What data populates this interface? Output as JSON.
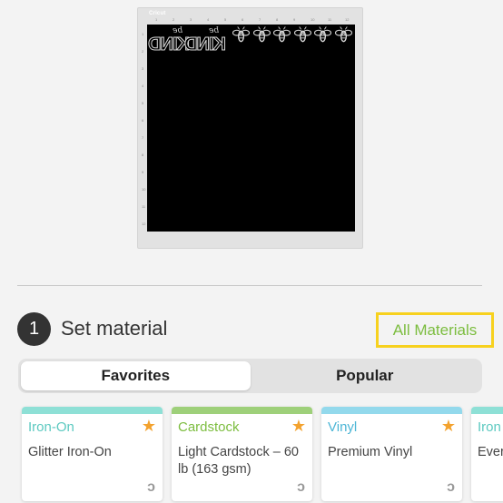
{
  "mat": {
    "brand": "Cricut",
    "ruler_top": [
      "1",
      "2",
      "3",
      "4",
      "5",
      "6",
      "7",
      "8",
      "9",
      "10",
      "11",
      "12"
    ],
    "ruler_left": [
      "1",
      "2",
      "3",
      "4",
      "5",
      "6",
      "7",
      "8",
      "9",
      "10",
      "11",
      "12"
    ],
    "design_text": "KIND",
    "design_script": "be"
  },
  "step": {
    "number": "1",
    "title": "Set material"
  },
  "all_materials_label": "All Materials",
  "tabs": [
    {
      "label": "Favorites",
      "active": true
    },
    {
      "label": "Popular",
      "active": false
    }
  ],
  "cards": [
    {
      "category": "Iron-On",
      "name": "Glitter Iron-On",
      "bar_color": "#8ee0d6",
      "category_color": "#5cc9c0",
      "starred": true
    },
    {
      "category": "Cardstock",
      "name": "Light Cardstock – 60 lb (163 gsm)",
      "bar_color": "#9ed07a",
      "category_color": "#7cbd3f",
      "starred": true
    },
    {
      "category": "Vinyl",
      "name": "Premium Vinyl",
      "bar_color": "#93d9ec",
      "category_color": "#4db6d6",
      "starred": true
    },
    {
      "category": "Iron",
      "name": "Ever",
      "bar_color": "#8ee0d6",
      "category_color": "#5cc9c0",
      "starred": false
    }
  ],
  "icons": {
    "star": "star-icon",
    "cricut_logo": "cricut-logo-icon"
  }
}
